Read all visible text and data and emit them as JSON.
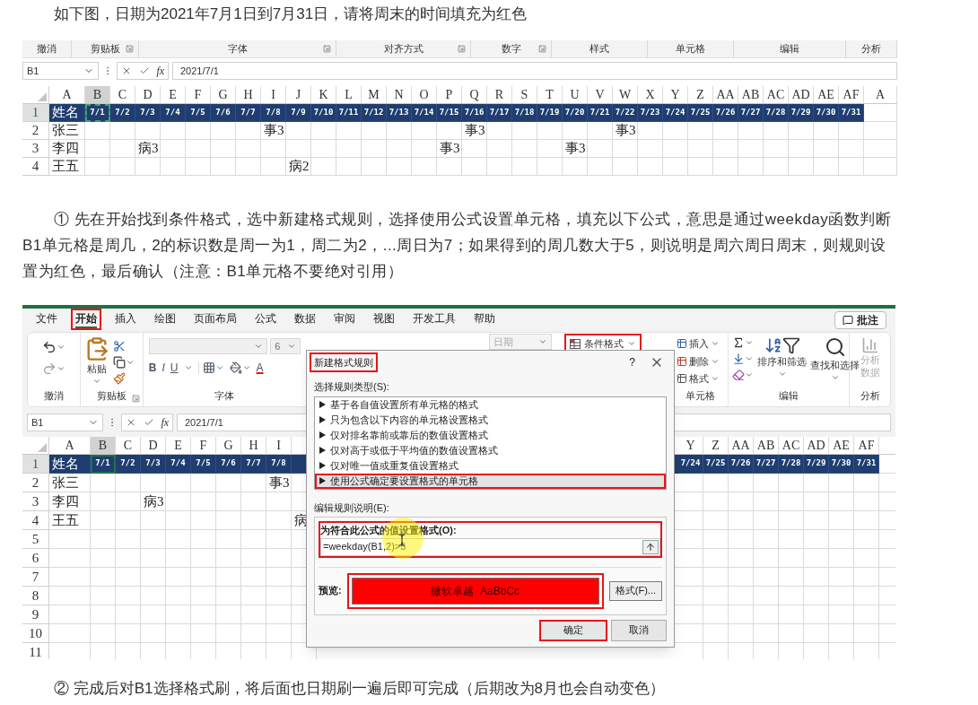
{
  "intro": "如下图，日期为2021年7月1日到7月31日，请将周末的时间填充为红色",
  "sheet_1": {
    "ribbon_groups": [
      {
        "label": "撤消",
        "launcher": false
      },
      {
        "label": "剪贴板",
        "launcher": true
      },
      {
        "label": "字体",
        "launcher": true
      },
      {
        "label": "对齐方式",
        "launcher": true
      },
      {
        "label": "数字",
        "launcher": true
      },
      {
        "label": "样式",
        "launcher": false
      },
      {
        "label": "单元格",
        "launcher": false
      },
      {
        "label": "编辑",
        "launcher": false
      },
      {
        "label": "分析",
        "launcher": false
      }
    ],
    "name_box": "B1",
    "fx": "fx",
    "formula": "2021/7/1",
    "copy_marquee": true,
    "columns": [
      {
        "letter": "A",
        "selected": false
      },
      {
        "letter": "B",
        "selected": true
      },
      {
        "letter": "C",
        "selected": false
      },
      {
        "letter": "D",
        "selected": false
      },
      {
        "letter": "E",
        "selected": false
      },
      {
        "letter": "F",
        "selected": false
      },
      {
        "letter": "G",
        "selected": false
      },
      {
        "letter": "H",
        "selected": false
      },
      {
        "letter": "I",
        "selected": false
      },
      {
        "letter": "J",
        "selected": false
      },
      {
        "letter": "K",
        "selected": false
      },
      {
        "letter": "L",
        "selected": false
      },
      {
        "letter": "M",
        "selected": false
      },
      {
        "letter": "N",
        "selected": false
      },
      {
        "letter": "O",
        "selected": false
      },
      {
        "letter": "P",
        "selected": false
      },
      {
        "letter": "Q",
        "selected": false
      },
      {
        "letter": "R",
        "selected": false
      },
      {
        "letter": "S",
        "selected": false
      },
      {
        "letter": "T",
        "selected": false
      },
      {
        "letter": "U",
        "selected": false
      },
      {
        "letter": "V",
        "selected": false
      },
      {
        "letter": "W",
        "selected": false
      },
      {
        "letter": "X",
        "selected": false
      },
      {
        "letter": "Y",
        "selected": false
      },
      {
        "letter": "Z",
        "selected": false
      },
      {
        "letter": "AA",
        "selected": false
      },
      {
        "letter": "AB",
        "selected": false
      },
      {
        "letter": "AC",
        "selected": false
      },
      {
        "letter": "AD",
        "selected": false
      },
      {
        "letter": "AE",
        "selected": false
      },
      {
        "letter": "AF",
        "selected": false
      },
      {
        "letter": "A",
        "selected": false
      }
    ],
    "rows": [
      {
        "number": "1",
        "kind": "header",
        "selected": true,
        "cells": [
          {
            "kind": "text",
            "text": "姓名"
          },
          {
            "kind": "text",
            "text": "7/1"
          },
          {
            "kind": "text",
            "text": "7/2"
          },
          {
            "kind": "text",
            "text": "7/3"
          },
          {
            "kind": "text",
            "text": "7/4"
          },
          {
            "kind": "text",
            "text": "7/5"
          },
          {
            "kind": "text",
            "text": "7/6"
          },
          {
            "kind": "text",
            "text": "7/7"
          },
          {
            "kind": "text",
            "text": "7/8"
          },
          {
            "kind": "text",
            "text": "7/9"
          },
          {
            "kind": "text",
            "text": "7/10"
          },
          {
            "kind": "text",
            "text": "7/11"
          },
          {
            "kind": "text",
            "text": "7/12"
          },
          {
            "kind": "text",
            "text": "7/13"
          },
          {
            "kind": "text",
            "text": "7/14"
          },
          {
            "kind": "text",
            "text": "7/15"
          },
          {
            "kind": "text",
            "text": "7/16"
          },
          {
            "kind": "text",
            "text": "7/17"
          },
          {
            "kind": "text",
            "text": "7/18"
          },
          {
            "kind": "text",
            "text": "7/19"
          },
          {
            "kind": "text",
            "text": "7/20"
          },
          {
            "kind": "text",
            "text": "7/21"
          },
          {
            "kind": "text",
            "text": "7/22"
          },
          {
            "kind": "text",
            "text": "7/23"
          },
          {
            "kind": "text",
            "text": "7/24"
          },
          {
            "kind": "text",
            "text": "7/25"
          },
          {
            "kind": "text",
            "text": "7/26"
          },
          {
            "kind": "text",
            "text": "7/27"
          },
          {
            "kind": "text",
            "text": "7/28"
          },
          {
            "kind": "text",
            "text": "7/29"
          },
          {
            "kind": "text",
            "text": "7/30"
          },
          {
            "kind": "text",
            "text": "7/31"
          }
        ]
      },
      {
        "number": "2",
        "kind": "body",
        "selected": false,
        "cells": [
          {
            "kind": "text",
            "text": "张三"
          },
          {
            "kind": "blank"
          },
          {
            "kind": "blank"
          },
          {
            "kind": "blank"
          },
          {
            "kind": "blank"
          },
          {
            "kind": "blank"
          },
          {
            "kind": "blank"
          },
          {
            "kind": "blank"
          },
          {
            "kind": "text",
            "text": "事3"
          },
          {
            "kind": "blank"
          },
          {
            "kind": "blank"
          },
          {
            "kind": "blank"
          },
          {
            "kind": "blank"
          },
          {
            "kind": "blank"
          },
          {
            "kind": "blank"
          },
          {
            "kind": "blank"
          },
          {
            "kind": "text",
            "text": "事3"
          },
          {
            "kind": "blank"
          },
          {
            "kind": "blank"
          },
          {
            "kind": "blank"
          },
          {
            "kind": "blank"
          },
          {
            "kind": "blank"
          },
          {
            "kind": "text",
            "text": "事3"
          }
        ]
      },
      {
        "number": "3",
        "kind": "body",
        "selected": false,
        "cells": [
          {
            "kind": "text",
            "text": "李四"
          },
          {
            "kind": "blank"
          },
          {
            "kind": "blank"
          },
          {
            "kind": "text",
            "text": "病3"
          },
          {
            "kind": "blank"
          },
          {
            "kind": "blank"
          },
          {
            "kind": "blank"
          },
          {
            "kind": "blank"
          },
          {
            "kind": "blank"
          },
          {
            "kind": "blank"
          },
          {
            "kind": "blank"
          },
          {
            "kind": "blank"
          },
          {
            "kind": "blank"
          },
          {
            "kind": "blank"
          },
          {
            "kind": "blank"
          },
          {
            "kind": "text",
            "text": "事3"
          },
          {
            "kind": "blank"
          },
          {
            "kind": "blank"
          },
          {
            "kind": "blank"
          },
          {
            "kind": "blank"
          },
          {
            "kind": "text",
            "text": "事3"
          }
        ]
      },
      {
        "number": "4",
        "kind": "body",
        "selected": false,
        "cells": [
          {
            "kind": "text",
            "text": "王五"
          },
          {
            "kind": "blank"
          },
          {
            "kind": "blank"
          },
          {
            "kind": "blank"
          },
          {
            "kind": "blank"
          },
          {
            "kind": "blank"
          },
          {
            "kind": "blank"
          },
          {
            "kind": "blank"
          },
          {
            "kind": "blank"
          },
          {
            "kind": "text",
            "text": "病2"
          }
        ]
      }
    ]
  },
  "step_1": "① 先在开始找到条件格式，选中新建格式规则，选择使用公式设置单元格，填充以下公式，意思是通过weekday函数判断B1单元格是周几，2的标识数是周一为1，周二为2，...周日为7；如果得到的周几数大于5，则说明是周六周日周末，则规则设置为红色，最后确认（注意：B1单元格不要绝对引用）",
  "sheet_2": {
    "tabs": [
      {
        "label": "文件",
        "selected": false,
        "annotated": false
      },
      {
        "label": "开始",
        "selected": true,
        "annotated": true
      },
      {
        "label": "插入",
        "selected": false,
        "annotated": false
      },
      {
        "label": "绘图",
        "selected": false,
        "annotated": false
      },
      {
        "label": "页面布局",
        "selected": false,
        "annotated": false
      },
      {
        "label": "公式",
        "selected": false,
        "annotated": false
      },
      {
        "label": "数据",
        "selected": false,
        "annotated": false
      },
      {
        "label": "审阅",
        "selected": false,
        "annotated": false
      },
      {
        "label": "视图",
        "selected": false,
        "annotated": false
      },
      {
        "label": "开发工具",
        "selected": false,
        "annotated": false
      },
      {
        "label": "帮助",
        "selected": false,
        "annotated": false
      }
    ],
    "comments": "批注",
    "undo": {
      "label": "撤消"
    },
    "clipboard": {
      "paste": "粘贴",
      "label": "剪贴板"
    },
    "font": {
      "size": "6",
      "styles": [
        "B",
        "I",
        "U"
      ],
      "font_color": "A",
      "label": "字体"
    },
    "number_format": "日期",
    "conditional_formatting": {
      "label": "条件格式",
      "annotated": true
    },
    "cells": {
      "items": [
        "插入",
        "删除",
        "格式"
      ],
      "label": "单元格"
    },
    "editing": {
      "sort": "排序和筛选",
      "find": "查找和选择",
      "label": "编辑"
    },
    "analysis": {
      "button": "分析数据",
      "label": "分析"
    },
    "name_box": "B1",
    "fx": "fx",
    "formula": "2021/7/1",
    "columns_left": [
      {
        "letter": "A",
        "selected": false
      },
      {
        "letter": "B",
        "selected": true
      },
      {
        "letter": "C",
        "selected": false
      },
      {
        "letter": "D",
        "selected": false
      },
      {
        "letter": "E",
        "selected": false
      },
      {
        "letter": "F",
        "selected": false
      },
      {
        "letter": "G",
        "selected": false
      },
      {
        "letter": "H",
        "selected": false
      },
      {
        "letter": "I",
        "selected": false
      },
      {
        "selected": false
      }
    ],
    "columns_right": [
      {
        "letter": "Y",
        "selected": false
      },
      {
        "letter": "Z",
        "selected": false
      },
      {
        "letter": "AA",
        "selected": false
      },
      {
        "letter": "AB",
        "selected": false
      },
      {
        "letter": "AC",
        "selected": false
      },
      {
        "letter": "AD",
        "selected": false
      },
      {
        "letter": "AE",
        "selected": false
      },
      {
        "letter": "AF",
        "selected": false
      }
    ],
    "rows": [
      {
        "number": "1",
        "kind": "header",
        "selected": true,
        "cells_left": [
          {
            "kind": "text",
            "text": "姓名"
          },
          {
            "kind": "text",
            "text": "7/1"
          },
          {
            "kind": "text",
            "text": "7/2"
          },
          {
            "kind": "text",
            "text": "7/3"
          },
          {
            "kind": "text",
            "text": "7/4"
          },
          {
            "kind": "text",
            "text": "7/5"
          },
          {
            "kind": "text",
            "text": "7/6"
          },
          {
            "kind": "text",
            "text": "7/7"
          },
          {
            "kind": "text",
            "text": "7/8"
          },
          {
            "kind": "blank"
          }
        ],
        "cells_right": [
          {
            "kind": "text",
            "text": "7/24"
          },
          {
            "kind": "text",
            "text": "7/25"
          },
          {
            "kind": "text",
            "text": "7/26"
          },
          {
            "kind": "text",
            "text": "7/27"
          },
          {
            "kind": "text",
            "text": "7/28"
          },
          {
            "kind": "text",
            "text": "7/29"
          },
          {
            "kind": "text",
            "text": "7/30"
          },
          {
            "kind": "text",
            "text": "7/31"
          }
        ]
      },
      {
        "number": "2",
        "kind": "body",
        "selected": false,
        "cells_left": [
          {
            "kind": "text",
            "text": "张三"
          },
          {
            "kind": "blank"
          },
          {
            "kind": "blank"
          },
          {
            "kind": "blank"
          },
          {
            "kind": "blank"
          },
          {
            "kind": "blank"
          },
          {
            "kind": "blank"
          },
          {
            "kind": "blank"
          },
          {
            "kind": "text",
            "text": "事3"
          }
        ]
      },
      {
        "number": "3",
        "kind": "body",
        "selected": false,
        "cells_left": [
          {
            "kind": "text",
            "text": "李四"
          },
          {
            "kind": "blank"
          },
          {
            "kind": "blank"
          },
          {
            "kind": "text",
            "text": "病3"
          }
        ]
      },
      {
        "number": "4",
        "kind": "body",
        "selected": false,
        "cells_left": [
          {
            "kind": "text",
            "text": "王五"
          },
          {
            "kind": "blank"
          },
          {
            "kind": "blank"
          },
          {
            "kind": "blank"
          },
          {
            "kind": "blank"
          },
          {
            "kind": "blank"
          },
          {
            "kind": "blank"
          },
          {
            "kind": "blank"
          },
          {
            "kind": "blank"
          },
          {
            "kind": "text",
            "text": "病"
          }
        ]
      },
      {
        "number": "5",
        "kind": "body",
        "selected": false
      },
      {
        "number": "6",
        "kind": "body",
        "selected": false
      },
      {
        "number": "7",
        "kind": "body",
        "selected": false
      },
      {
        "number": "8",
        "kind": "body",
        "selected": false
      },
      {
        "number": "9",
        "kind": "body",
        "selected": false
      },
      {
        "number": "10",
        "kind": "body",
        "selected": false
      },
      {
        "number": "11",
        "kind": "body",
        "selected": false
      }
    ],
    "dialog": {
      "title": "新建格式规则",
      "title_annotated": true,
      "help": "?",
      "rule_type_label": "选择规则类型(S):",
      "rule_types": [
        {
          "label": "基于各自值设置所有单元格的格式",
          "selected": false,
          "annotated": false
        },
        {
          "label": "只为包含以下内容的单元格设置格式",
          "selected": false,
          "annotated": false
        },
        {
          "label": "仅对排名靠前或靠后的数值设置格式",
          "selected": false,
          "annotated": false
        },
        {
          "label": "仅对高于或低于平均值的数值设置格式",
          "selected": false,
          "annotated": false
        },
        {
          "label": "仅对唯一值或重复值设置格式",
          "selected": false,
          "annotated": false
        },
        {
          "label": "使用公式确定要设置格式的单元格",
          "selected": true,
          "annotated": true
        }
      ],
      "description_label": "编辑规则说明(E):",
      "formula_label": "为符合此公式的值设置格式(O):",
      "formula": "=weekday(B1,2)>5",
      "formula_annotated": true,
      "preview_label": "预览:",
      "preview_text": "微软卓越  AaBbCc",
      "preview_annotated": true,
      "format_button": "格式(F)...",
      "ok": "确定",
      "ok_annotated": true,
      "cancel": "取消"
    }
  },
  "step_2": "② 完成后对B1选择格式刷，将后面也日期刷一遍后即可完成（后期改为8月也会自动变色）"
}
